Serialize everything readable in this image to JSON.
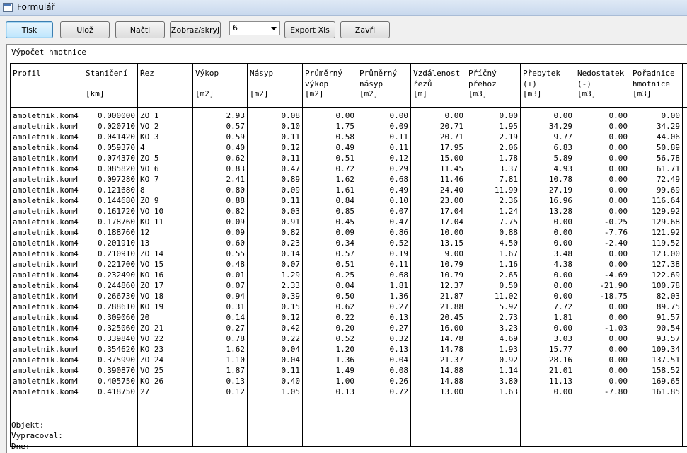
{
  "window": {
    "title": "Formulář"
  },
  "toolbar": {
    "print": "Tisk",
    "save": "Ulož",
    "load": "Načti",
    "toggle": "Zobraz/skryj",
    "select_value": "6",
    "export": "Export Xls",
    "close": "Zavři"
  },
  "report": {
    "title": "Výpočet hmotnice",
    "columns": [
      {
        "label": "Profil",
        "unit": ""
      },
      {
        "label": "Staničení",
        "unit": "[km]"
      },
      {
        "label": "Řez",
        "unit": ""
      },
      {
        "label": "Výkop",
        "unit": "[m2]"
      },
      {
        "label": "Násyp",
        "unit": "[m2]"
      },
      {
        "label": "Průměrný\nvýkop",
        "unit": "[m2]"
      },
      {
        "label": "Průměrný\nnásyp",
        "unit": "[m2]"
      },
      {
        "label": "Vzdálenost\nřezů",
        "unit": "[m]"
      },
      {
        "label": "Příčný\npřehoz",
        "unit": "[m3]"
      },
      {
        "label": "Přebytek\n(+)",
        "unit": "[m3]"
      },
      {
        "label": "Nedostatek\n(-)",
        "unit": "[m3]"
      },
      {
        "label": "Pořadnice\nhmotnice",
        "unit": "[m3]"
      }
    ],
    "rows": [
      [
        "amoletnik.kom4",
        "0.000000",
        "ZO 1",
        "2.93",
        "0.08",
        "0.00",
        "0.00",
        "0.00",
        "0.00",
        "0.00",
        "0.00",
        "0.00"
      ],
      [
        "amoletnik.kom4",
        "0.020710",
        "VO 2",
        "0.57",
        "0.10",
        "1.75",
        "0.09",
        "20.71",
        "1.95",
        "34.29",
        "0.00",
        "34.29"
      ],
      [
        "amoletnik.kom4",
        "0.041420",
        "KO 3",
        "0.59",
        "0.11",
        "0.58",
        "0.11",
        "20.71",
        "2.19",
        "9.77",
        "0.00",
        "44.06"
      ],
      [
        "amoletnik.kom4",
        "0.059370",
        "4",
        "0.40",
        "0.12",
        "0.49",
        "0.11",
        "17.95",
        "2.06",
        "6.83",
        "0.00",
        "50.89"
      ],
      [
        "amoletnik.kom4",
        "0.074370",
        "ZO 5",
        "0.62",
        "0.11",
        "0.51",
        "0.12",
        "15.00",
        "1.78",
        "5.89",
        "0.00",
        "56.78"
      ],
      [
        "amoletnik.kom4",
        "0.085820",
        "VO 6",
        "0.83",
        "0.47",
        "0.72",
        "0.29",
        "11.45",
        "3.37",
        "4.93",
        "0.00",
        "61.71"
      ],
      [
        "amoletnik.kom4",
        "0.097280",
        "KO 7",
        "2.41",
        "0.89",
        "1.62",
        "0.68",
        "11.46",
        "7.81",
        "10.78",
        "0.00",
        "72.49"
      ],
      [
        "amoletnik.kom4",
        "0.121680",
        "8",
        "0.80",
        "0.09",
        "1.61",
        "0.49",
        "24.40",
        "11.99",
        "27.19",
        "0.00",
        "99.69"
      ],
      [
        "amoletnik.kom4",
        "0.144680",
        "ZO 9",
        "0.88",
        "0.11",
        "0.84",
        "0.10",
        "23.00",
        "2.36",
        "16.96",
        "0.00",
        "116.64"
      ],
      [
        "amoletnik.kom4",
        "0.161720",
        "VO 10",
        "0.82",
        "0.03",
        "0.85",
        "0.07",
        "17.04",
        "1.24",
        "13.28",
        "0.00",
        "129.92"
      ],
      [
        "amoletnik.kom4",
        "0.178760",
        "KO 11",
        "0.09",
        "0.91",
        "0.45",
        "0.47",
        "17.04",
        "7.75",
        "0.00",
        "-0.25",
        "129.68"
      ],
      [
        "amoletnik.kom4",
        "0.188760",
        "12",
        "0.09",
        "0.82",
        "0.09",
        "0.86",
        "10.00",
        "0.88",
        "0.00",
        "-7.76",
        "121.92"
      ],
      [
        "amoletnik.kom4",
        "0.201910",
        "13",
        "0.60",
        "0.23",
        "0.34",
        "0.52",
        "13.15",
        "4.50",
        "0.00",
        "-2.40",
        "119.52"
      ],
      [
        "amoletnik.kom4",
        "0.210910",
        "ZO 14",
        "0.55",
        "0.14",
        "0.57",
        "0.19",
        "9.00",
        "1.67",
        "3.48",
        "0.00",
        "123.00"
      ],
      [
        "amoletnik.kom4",
        "0.221700",
        "VO 15",
        "0.48",
        "0.07",
        "0.51",
        "0.11",
        "10.79",
        "1.16",
        "4.38",
        "0.00",
        "127.38"
      ],
      [
        "amoletnik.kom4",
        "0.232490",
        "KO 16",
        "0.01",
        "1.29",
        "0.25",
        "0.68",
        "10.79",
        "2.65",
        "0.00",
        "-4.69",
        "122.69"
      ],
      [
        "amoletnik.kom4",
        "0.244860",
        "ZO 17",
        "0.07",
        "2.33",
        "0.04",
        "1.81",
        "12.37",
        "0.50",
        "0.00",
        "-21.90",
        "100.78"
      ],
      [
        "amoletnik.kom4",
        "0.266730",
        "VO 18",
        "0.94",
        "0.39",
        "0.50",
        "1.36",
        "21.87",
        "11.02",
        "0.00",
        "-18.75",
        "82.03"
      ],
      [
        "amoletnik.kom4",
        "0.288610",
        "KO 19",
        "0.31",
        "0.15",
        "0.62",
        "0.27",
        "21.88",
        "5.92",
        "7.72",
        "0.00",
        "89.75"
      ],
      [
        "amoletnik.kom4",
        "0.309060",
        "20",
        "0.14",
        "0.12",
        "0.22",
        "0.13",
        "20.45",
        "2.73",
        "1.81",
        "0.00",
        "91.57"
      ],
      [
        "amoletnik.kom4",
        "0.325060",
        "ZO 21",
        "0.27",
        "0.42",
        "0.20",
        "0.27",
        "16.00",
        "3.23",
        "0.00",
        "-1.03",
        "90.54"
      ],
      [
        "amoletnik.kom4",
        "0.339840",
        "VO 22",
        "0.78",
        "0.22",
        "0.52",
        "0.32",
        "14.78",
        "4.69",
        "3.03",
        "0.00",
        "93.57"
      ],
      [
        "amoletnik.kom4",
        "0.354620",
        "KO 23",
        "1.62",
        "0.04",
        "1.20",
        "0.13",
        "14.78",
        "1.93",
        "15.77",
        "0.00",
        "109.34"
      ],
      [
        "amoletnik.kom4",
        "0.375990",
        "ZO 24",
        "1.10",
        "0.04",
        "1.36",
        "0.04",
        "21.37",
        "0.92",
        "28.16",
        "0.00",
        "137.51"
      ],
      [
        "amoletnik.kom4",
        "0.390870",
        "VO 25",
        "1.87",
        "0.11",
        "1.49",
        "0.08",
        "14.88",
        "1.14",
        "21.01",
        "0.00",
        "158.52"
      ],
      [
        "amoletnik.kom4",
        "0.405750",
        "KO 26",
        "0.13",
        "0.40",
        "1.00",
        "0.26",
        "14.88",
        "3.80",
        "11.13",
        "0.00",
        "169.65"
      ],
      [
        "amoletnik.kom4",
        "0.418750",
        "27",
        "0.12",
        "1.05",
        "0.13",
        "0.72",
        "13.00",
        "1.63",
        "0.00",
        "-7.80",
        "161.85"
      ]
    ],
    "footer": {
      "object": "Objekt:",
      "prepared_by": "Vypracoval:",
      "date": "Dne:"
    }
  }
}
